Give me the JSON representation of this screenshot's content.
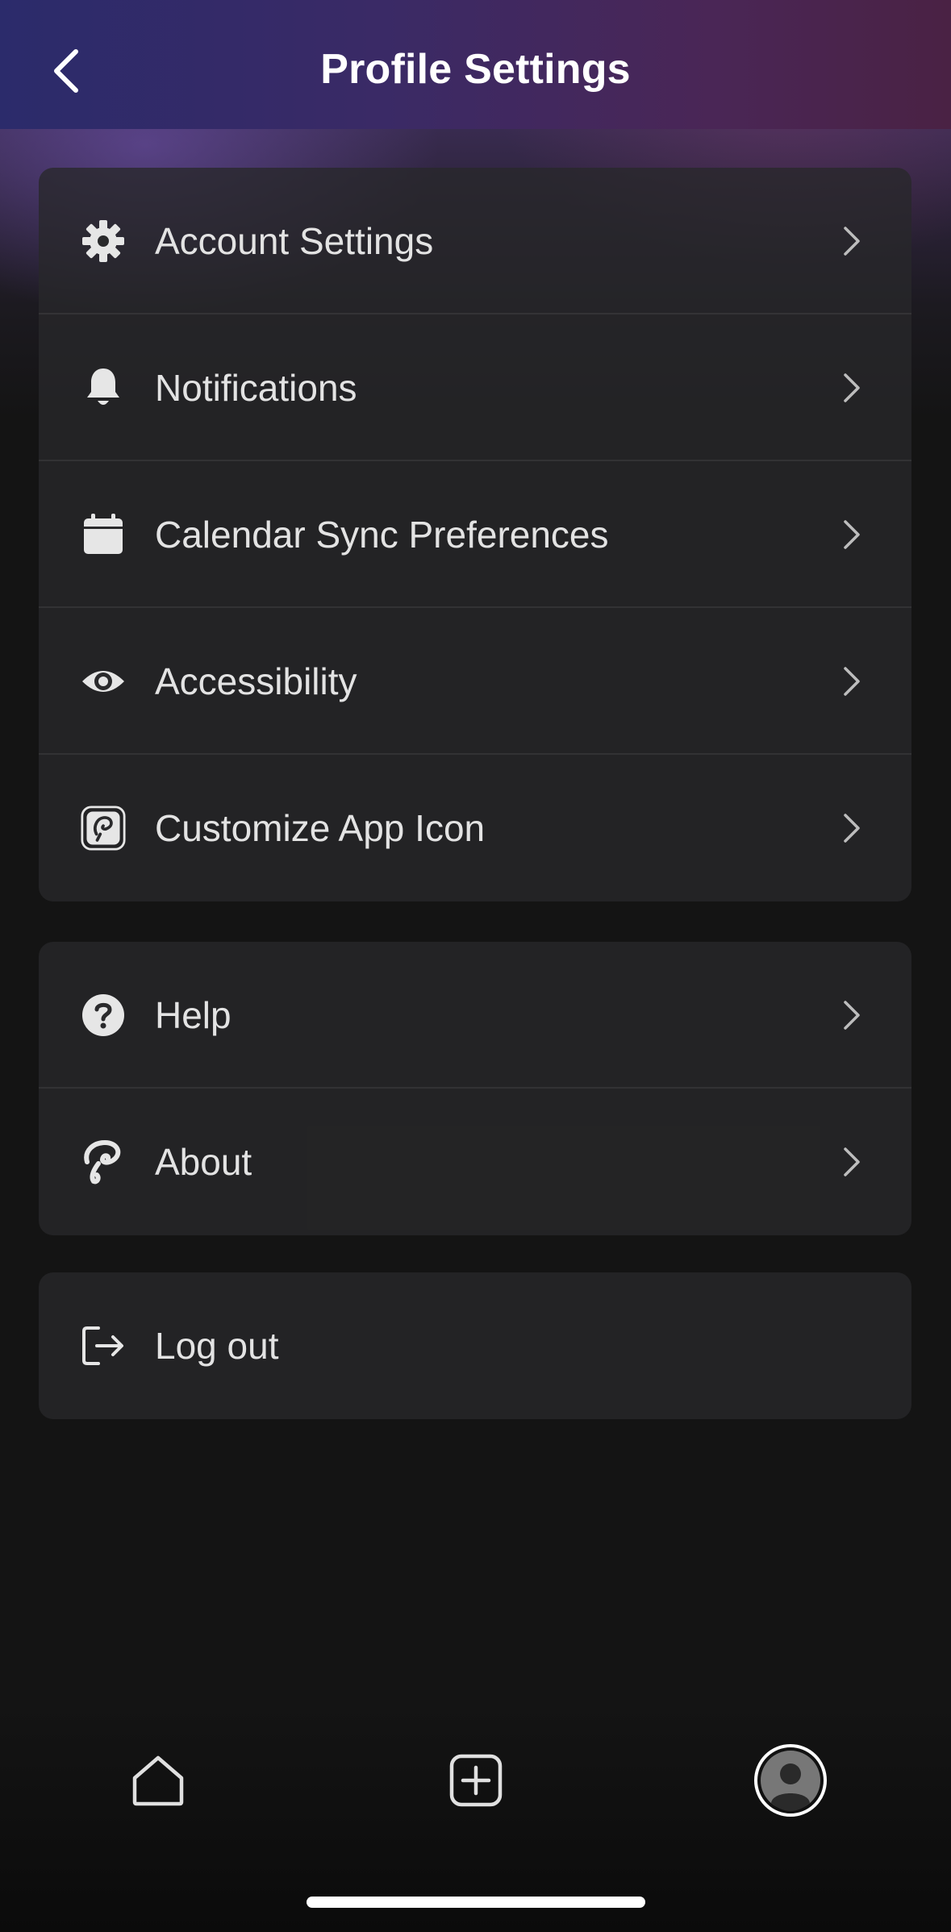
{
  "header": {
    "title": "Profile Settings",
    "back_icon": "chevron-left-icon"
  },
  "groups": [
    {
      "items": [
        {
          "label": "Account Settings",
          "icon": "gear-icon"
        },
        {
          "label": "Notifications",
          "icon": "bell-icon"
        },
        {
          "label": "Calendar Sync Preferences",
          "icon": "calendar-icon"
        },
        {
          "label": "Accessibility",
          "icon": "eye-icon"
        },
        {
          "label": "Customize App Icon",
          "icon": "app-logo-icon"
        }
      ]
    },
    {
      "items": [
        {
          "label": "Help",
          "icon": "question-circle-icon"
        },
        {
          "label": "About",
          "icon": "app-logo-icon"
        }
      ]
    },
    {
      "items": [
        {
          "label": "Log out",
          "icon": "logout-icon"
        }
      ]
    }
  ],
  "tabbar": {
    "items": [
      {
        "icon": "home-icon"
      },
      {
        "icon": "plus-square-icon"
      },
      {
        "icon": "avatar-icon",
        "selected": true
      }
    ]
  },
  "colors": {
    "background": "#141414",
    "card": "#282828",
    "text": "#e3e3e3",
    "header_gradient_start": "#2b2b6b",
    "header_gradient_end": "#4a2244"
  }
}
